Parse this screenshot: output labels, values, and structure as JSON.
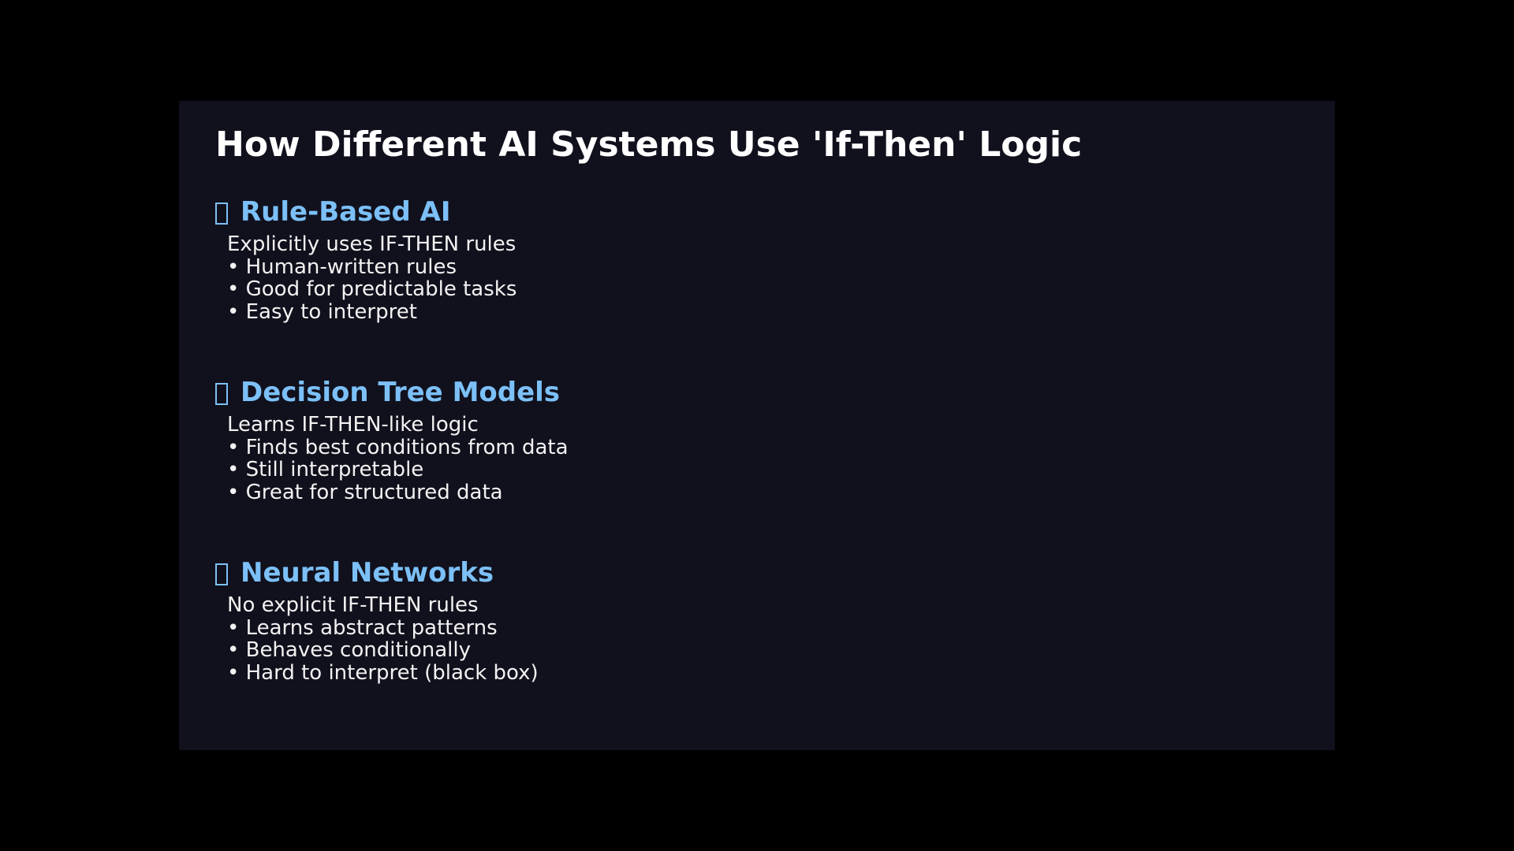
{
  "slide": {
    "title": "How Different AI Systems Use 'If-Then' Logic",
    "colors": {
      "background": "#11111d",
      "outer_background": "#000000",
      "title": "#ffffff",
      "heading": "#7cc0f7",
      "body": "#f2f2f2"
    },
    "sections": [
      {
        "icon": "missing-glyph-icon",
        "heading": "Rule-Based AI",
        "summary": "Explicitly uses IF-THEN rules",
        "bullets": [
          "• Human-written rules",
          "• Good for predictable tasks",
          "• Easy to interpret"
        ]
      },
      {
        "icon": "missing-glyph-icon",
        "heading": "Decision Tree Models",
        "summary": "Learns IF-THEN-like logic",
        "bullets": [
          "• Finds best conditions from data",
          "• Still interpretable",
          "• Great for structured data"
        ]
      },
      {
        "icon": "missing-glyph-icon",
        "heading": "Neural Networks",
        "summary": "No explicit IF-THEN rules",
        "bullets": [
          "• Learns abstract patterns",
          "• Behaves conditionally",
          "• Hard to interpret (black box)"
        ]
      }
    ]
  }
}
